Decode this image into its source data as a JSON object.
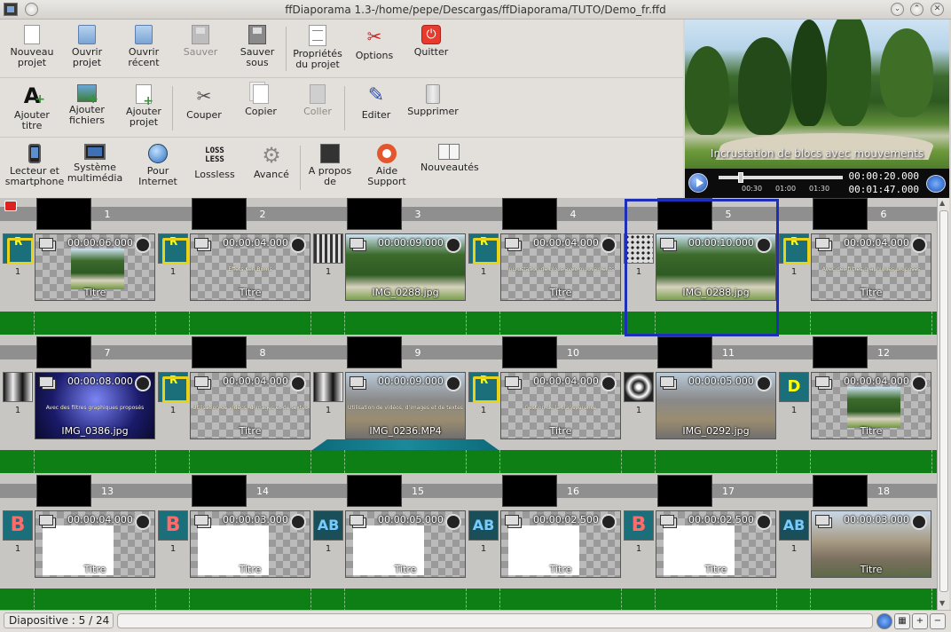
{
  "window": {
    "title": "ffDiaporama 1.3-/home/pepe/Descargas/ffDiaporama/TUTO/Demo_fr.ffd",
    "btn_minimize": "⌄",
    "btn_maximize": "⌃",
    "btn_close": "✕"
  },
  "toolbar": {
    "row1": [
      {
        "id": "nouveau",
        "label": "Nouveau projet",
        "icon": "new-document-icon"
      },
      {
        "id": "ouvrir",
        "label": "Ouvrir projet",
        "icon": "open-folder-icon"
      },
      {
        "id": "recent",
        "label": "Ouvrir récent",
        "icon": "open-recent-icon"
      },
      {
        "id": "sauver",
        "label": "Sauver",
        "icon": "save-icon",
        "disabled": true
      },
      {
        "id": "sauversous",
        "label": "Sauver sous",
        "icon": "save-as-icon"
      },
      {
        "id": "props",
        "label": "Propriétés du projet",
        "icon": "properties-icon"
      },
      {
        "id": "options",
        "label": "Options",
        "icon": "tools-icon"
      },
      {
        "id": "quitter",
        "label": "Quitter",
        "icon": "power-icon"
      }
    ],
    "row2": [
      {
        "id": "titre",
        "label": "Ajouter titre",
        "icon": "add-title-icon"
      },
      {
        "id": "fichiers",
        "label": "Ajouter fichiers",
        "icon": "add-files-icon"
      },
      {
        "id": "ajprojet",
        "label": "Ajouter projet",
        "icon": "add-project-icon"
      },
      {
        "id": "couper",
        "label": "Couper",
        "icon": "scissors-icon"
      },
      {
        "id": "copier",
        "label": "Copier",
        "icon": "copy-icon"
      },
      {
        "id": "coller",
        "label": "Coller",
        "icon": "paste-icon",
        "disabled": true
      },
      {
        "id": "editer",
        "label": "Editer",
        "icon": "pen-icon"
      },
      {
        "id": "supprimer",
        "label": "Supprimer",
        "icon": "trash-icon"
      }
    ],
    "row3": [
      {
        "id": "lecteur",
        "label": "Lecteur et smartphone",
        "icon": "phone-icon"
      },
      {
        "id": "systeme",
        "label": "Système multimédia",
        "icon": "monitor-icon"
      },
      {
        "id": "internet",
        "label": "Pour Internet",
        "icon": "globe-icon"
      },
      {
        "id": "lossless",
        "label": "Lossless",
        "icon": "lossless-icon",
        "glyph": "LOSS LESS"
      },
      {
        "id": "avance",
        "label": "Avancé",
        "icon": "gear-icon"
      },
      {
        "id": "apropos",
        "label": "A propos de",
        "icon": "about-icon"
      },
      {
        "id": "aide",
        "label": "Aide Support",
        "icon": "lifebuoy-icon"
      },
      {
        "id": "nouveautes",
        "label": "Nouveautés",
        "icon": "book-icon"
      }
    ]
  },
  "preview": {
    "caption": "Incrustation de blocs avec mouvements",
    "tick_labels": [
      "00:30",
      "01:00",
      "01:30"
    ],
    "current_time": "00:00:20.000",
    "total_time": "00:01:47.000"
  },
  "timeline": {
    "rows": [
      {
        "slides": [
          {
            "num": "1",
            "duration": "00:00:06.000",
            "name": "Titre",
            "subtitle": "",
            "transition": "slide-arrows",
            "trans_count": "1",
            "bg": "park-collage"
          },
          {
            "num": "2",
            "duration": "00:00:04.000",
            "name": "Titre",
            "subtitle": "Effets Ken Burns",
            "transition": "slide-arrows",
            "trans_count": "1",
            "bg": "checker"
          },
          {
            "num": "3",
            "duration": "00:00:09.000",
            "name": "IMG_0288.jpg",
            "subtitle": "",
            "transition": "bars",
            "trans_count": "1",
            "bg": "park"
          },
          {
            "num": "4",
            "duration": "00:00:04.000",
            "name": "Titre",
            "subtitle": "Incrustation de blocs avec mouvements",
            "transition": "slide-arrows",
            "trans_count": "1",
            "bg": "checker"
          },
          {
            "num": "5",
            "duration": "00:00:10.000",
            "name": "IMG_0288.jpg",
            "subtitle": "",
            "transition": "dots",
            "trans_count": "1",
            "bg": "park"
          },
          {
            "num": "6",
            "duration": "00:00:04.000",
            "name": "Titre",
            "subtitle": "Avec des filtres graphiques proposés",
            "transition": "slide-arrows",
            "trans_count": "1",
            "bg": "checker"
          }
        ]
      },
      {
        "slides": [
          {
            "num": "7",
            "duration": "00:00:08.000",
            "name": "IMG_0386.jpg",
            "subtitle": "Avec des filtres graphiques proposés",
            "transition": "gradient",
            "trans_count": "1",
            "bg": "church"
          },
          {
            "num": "8",
            "duration": "00:00:04.000",
            "name": "Titre",
            "subtitle": "Utilisation de vidéos, d'images et de textes",
            "transition": "slide-arrows",
            "trans_count": "1",
            "bg": "checker"
          },
          {
            "num": "9",
            "duration": "00:00:09.000",
            "name": "IMG_0236.MP4",
            "subtitle": "Utilisation de vidéos, d'images et de textes",
            "transition": "gradient",
            "trans_count": "1",
            "bg": "street"
          },
          {
            "num": "10",
            "duration": "00:00:04.000",
            "name": "Titre",
            "subtitle": "Gestion de la transparence",
            "transition": "slide-arrows",
            "trans_count": "1",
            "bg": "checker"
          },
          {
            "num": "11",
            "duration": "00:00:05.000",
            "name": "IMG_0292.jpg",
            "subtitle": "",
            "transition": "swirl",
            "trans_count": "1",
            "bg": "street"
          },
          {
            "num": "12",
            "duration": "00:00:04.000",
            "name": "Titre",
            "subtitle": "",
            "transition": "D",
            "trans_count": "1",
            "bg": "park-collage"
          }
        ]
      },
      {
        "slides": [
          {
            "num": "13",
            "duration": "00:00:04.000",
            "name": "Titre",
            "subtitle": "",
            "transition": "B",
            "trans_count": "1",
            "bg": "white"
          },
          {
            "num": "14",
            "duration": "00:00:03.000",
            "name": "Titre",
            "subtitle": "",
            "transition": "B",
            "trans_count": "1",
            "bg": "white"
          },
          {
            "num": "15",
            "duration": "00:00:05.000",
            "name": "Titre",
            "subtitle": "",
            "transition": "AB",
            "trans_count": "1",
            "bg": "white"
          },
          {
            "num": "16",
            "duration": "00:00:02.500",
            "name": "Titre",
            "subtitle": "",
            "transition": "AB",
            "trans_count": "1",
            "bg": "white"
          },
          {
            "num": "17",
            "duration": "00:00:02.500",
            "name": "Titre",
            "subtitle": "",
            "transition": "B",
            "trans_count": "1",
            "bg": "white"
          },
          {
            "num": "18",
            "duration": "00:00:03.000",
            "name": "Titre",
            "subtitle": "",
            "transition": "AB",
            "trans_count": "1",
            "bg": "castle"
          }
        ]
      }
    ],
    "selected_slide": "5"
  },
  "status": {
    "text": "Diapositive : 5 / 24"
  }
}
